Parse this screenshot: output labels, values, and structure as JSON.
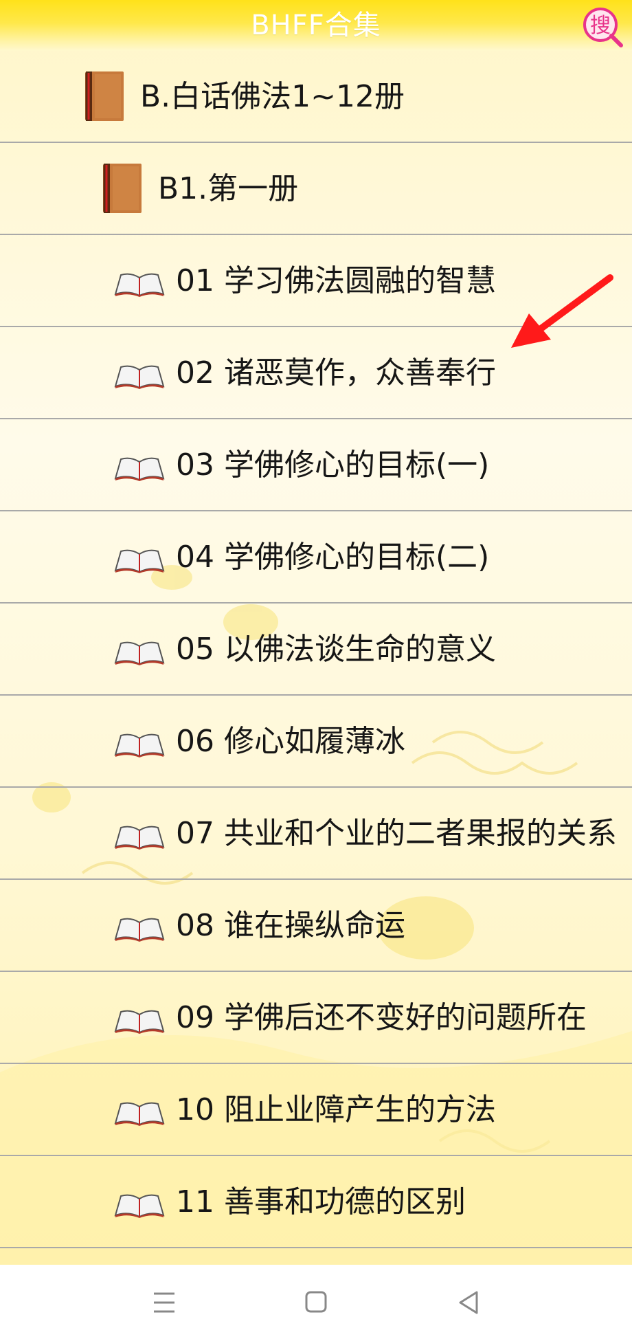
{
  "app": {
    "title": "BHFF合集",
    "search_glyph": "搜"
  },
  "tree": {
    "book": {
      "label": "B.白话佛法1~12册",
      "icon": "book-icon",
      "expanded": true
    },
    "volume": {
      "label": "B1.第一册",
      "icon": "book-icon",
      "expanded": true
    },
    "chapters": [
      {
        "label": "01 学习佛法圆融的智慧"
      },
      {
        "label": "02 诸恶莫作，众善奉行"
      },
      {
        "label": "03 学佛修心的目标(一)"
      },
      {
        "label": "04 学佛修心的目标(二)"
      },
      {
        "label": "05 以佛法谈生命的意义"
      },
      {
        "label": "06 修心如履薄冰"
      },
      {
        "label": "07 共业和个业的二者果报的关系"
      },
      {
        "label": "08 谁在操纵命运"
      },
      {
        "label": "09 学佛后还不变好的问题所在"
      },
      {
        "label": "10 阻止业障产生的方法"
      },
      {
        "label": "11 善事和功德的区别"
      }
    ]
  },
  "navbar": {
    "menu": "menu-icon",
    "home": "home-icon",
    "back": "back-icon"
  },
  "colors": {
    "header": "#ffe21a",
    "search": "#e8338a",
    "arrow": "#ff1a1a",
    "triangle": "#b01a1a"
  }
}
